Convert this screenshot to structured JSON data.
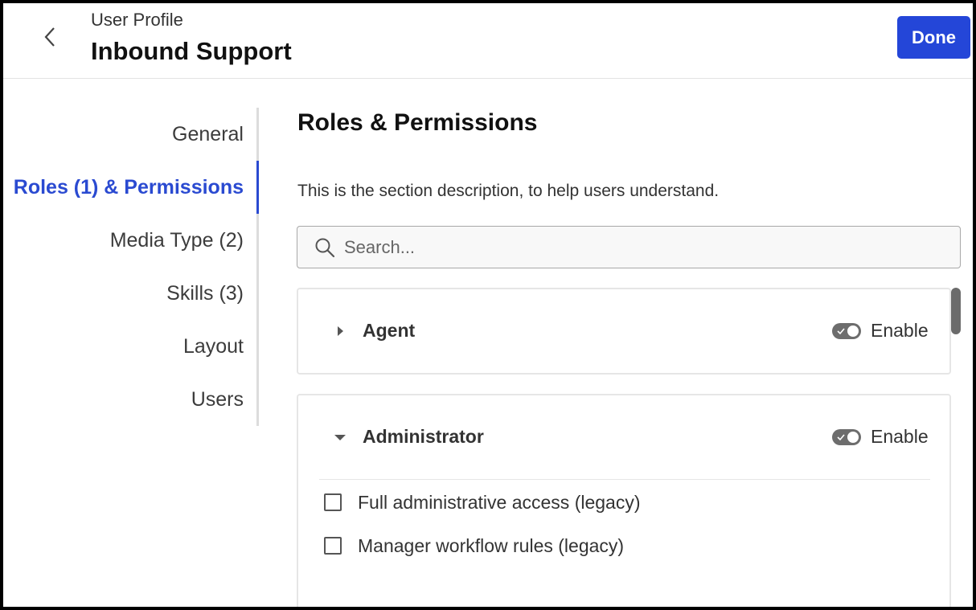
{
  "header": {
    "subtitle": "User Profile",
    "title": "Inbound Support",
    "done_label": "Done"
  },
  "sidenav": {
    "items": [
      {
        "label": "General"
      },
      {
        "label": "Roles (1) & Permissions",
        "active": true
      },
      {
        "label": "Media Type (2)"
      },
      {
        "label": "Skills (3)"
      },
      {
        "label": "Layout"
      },
      {
        "label": "Users"
      }
    ]
  },
  "section": {
    "title": "Roles & Permissions",
    "description": "This is the section description, to help users understand."
  },
  "search": {
    "placeholder": "Search..."
  },
  "roles": [
    {
      "name": "Agent",
      "expanded": false,
      "toggle_label": "Enable",
      "enabled": true,
      "permissions": []
    },
    {
      "name": "Administrator",
      "expanded": true,
      "toggle_label": "Enable",
      "enabled": true,
      "permissions": [
        {
          "label": "Full administrative access (legacy)",
          "checked": false
        },
        {
          "label": "Manager workflow rules (legacy)",
          "checked": false
        }
      ]
    }
  ],
  "colors": {
    "accent": "#2a4ad1",
    "done_button": "#2446d8",
    "toggle": "#6d6d6d"
  }
}
